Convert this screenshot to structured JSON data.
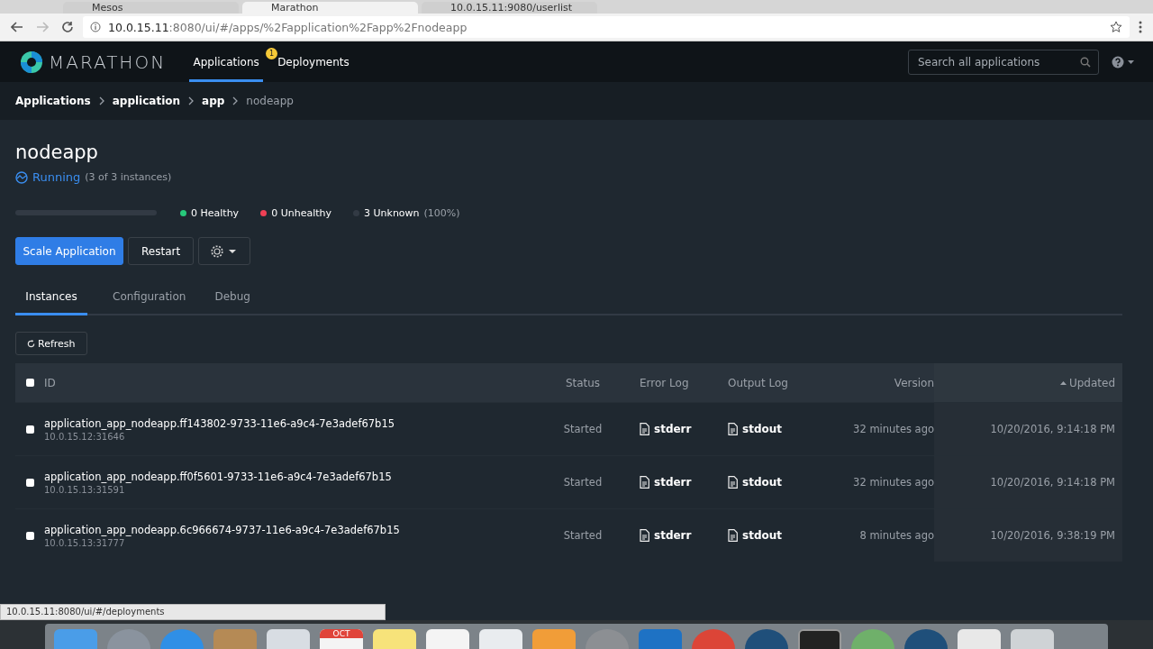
{
  "browser": {
    "tabs": [
      {
        "title": "Mesos",
        "selected": false
      },
      {
        "title": "Marathon",
        "selected": true
      },
      {
        "title": "10.0.15.11:9080/userlist",
        "selected": false
      }
    ],
    "address": {
      "host": "10.0.15.11",
      "rest": ":8080/ui/#/apps/%2Fapplication%2Fapp%2Fnodeapp"
    }
  },
  "nav": {
    "logo": "MARATHON",
    "items": [
      {
        "label": "Applications",
        "selected": true
      },
      {
        "label": "Deployments",
        "selected": false,
        "badge": "1"
      }
    ],
    "search": {
      "placeholder": "Search all applications"
    }
  },
  "breadcrumb": [
    "Applications",
    "application",
    "app",
    "nodeapp"
  ],
  "app": {
    "name": "nodeapp",
    "status": "Running",
    "instances": "(3 of 3 instances)",
    "health": [
      {
        "label": "0 Healthy",
        "color": "#27c97b"
      },
      {
        "label": "0 Unhealthy",
        "color": "#ef4055"
      },
      {
        "label": "3 Unknown",
        "note": "(100%)",
        "color": "#323a44"
      }
    ]
  },
  "actions": [
    "Scale Application",
    "Restart"
  ],
  "tabs": [
    {
      "label": "Instances",
      "selected": true
    },
    {
      "label": "Configuration",
      "selected": false
    },
    {
      "label": "Debug",
      "selected": false
    }
  ],
  "refresh": "Refresh",
  "table": {
    "select_all": {
      "checked": false
    },
    "columns": [
      {
        "label": "ID",
        "sorted": false
      },
      {
        "label": "Status",
        "sorted": false
      },
      {
        "label": "Error Log",
        "sorted": false
      },
      {
        "label": "Output Log",
        "sorted": false
      },
      {
        "label": "Version",
        "sorted": false
      },
      {
        "label": "Updated",
        "sorted": true
      }
    ],
    "rows": [
      {
        "checked": false,
        "id": "application_app_nodeapp.ff143802-9733-11e6-a9c4-7e3adef67b15",
        "host": "10.0.15.12:31646",
        "status": "Started",
        "error_log": "stderr",
        "output_log": "stdout",
        "version": "32 minutes ago",
        "updated": "10/20/2016, 9:14:18 PM"
      },
      {
        "checked": false,
        "id": "application_app_nodeapp.ff0f5601-9733-11e6-a9c4-7e3adef67b15",
        "host": "10.0.15.13:31591",
        "status": "Started",
        "error_log": "stderr",
        "output_log": "stdout",
        "version": "32 minutes ago",
        "updated": "10/20/2016, 9:14:18 PM"
      },
      {
        "checked": false,
        "id": "application_app_nodeapp.6c966674-9737-11e6-a9c4-7e3adef67b15",
        "host": "10.0.15.13:31777",
        "status": "Started",
        "error_log": "stderr",
        "output_log": "stdout",
        "version": "8 minutes ago",
        "updated": "10/20/2016, 9:38:19 PM"
      }
    ]
  },
  "status_url": "10.0.15.11:8080/ui/#/deployments",
  "dock": [
    {
      "kind": "finder"
    },
    {
      "kind": "rocket"
    },
    {
      "kind": "compass"
    },
    {
      "kind": "book"
    },
    {
      "kind": "mail"
    },
    {
      "kind": "calendar",
      "label": "OCT"
    },
    {
      "kind": "notes"
    },
    {
      "kind": "reminders"
    },
    {
      "kind": "board"
    },
    {
      "kind": "pages"
    },
    {
      "kind": "gear"
    },
    {
      "kind": "outlook"
    },
    {
      "kind": "chrome"
    },
    {
      "kind": "circle"
    },
    {
      "kind": "terminal"
    },
    {
      "kind": "globe"
    },
    {
      "kind": "circle"
    },
    {
      "kind": "doc"
    },
    {
      "kind": "trash"
    }
  ]
}
